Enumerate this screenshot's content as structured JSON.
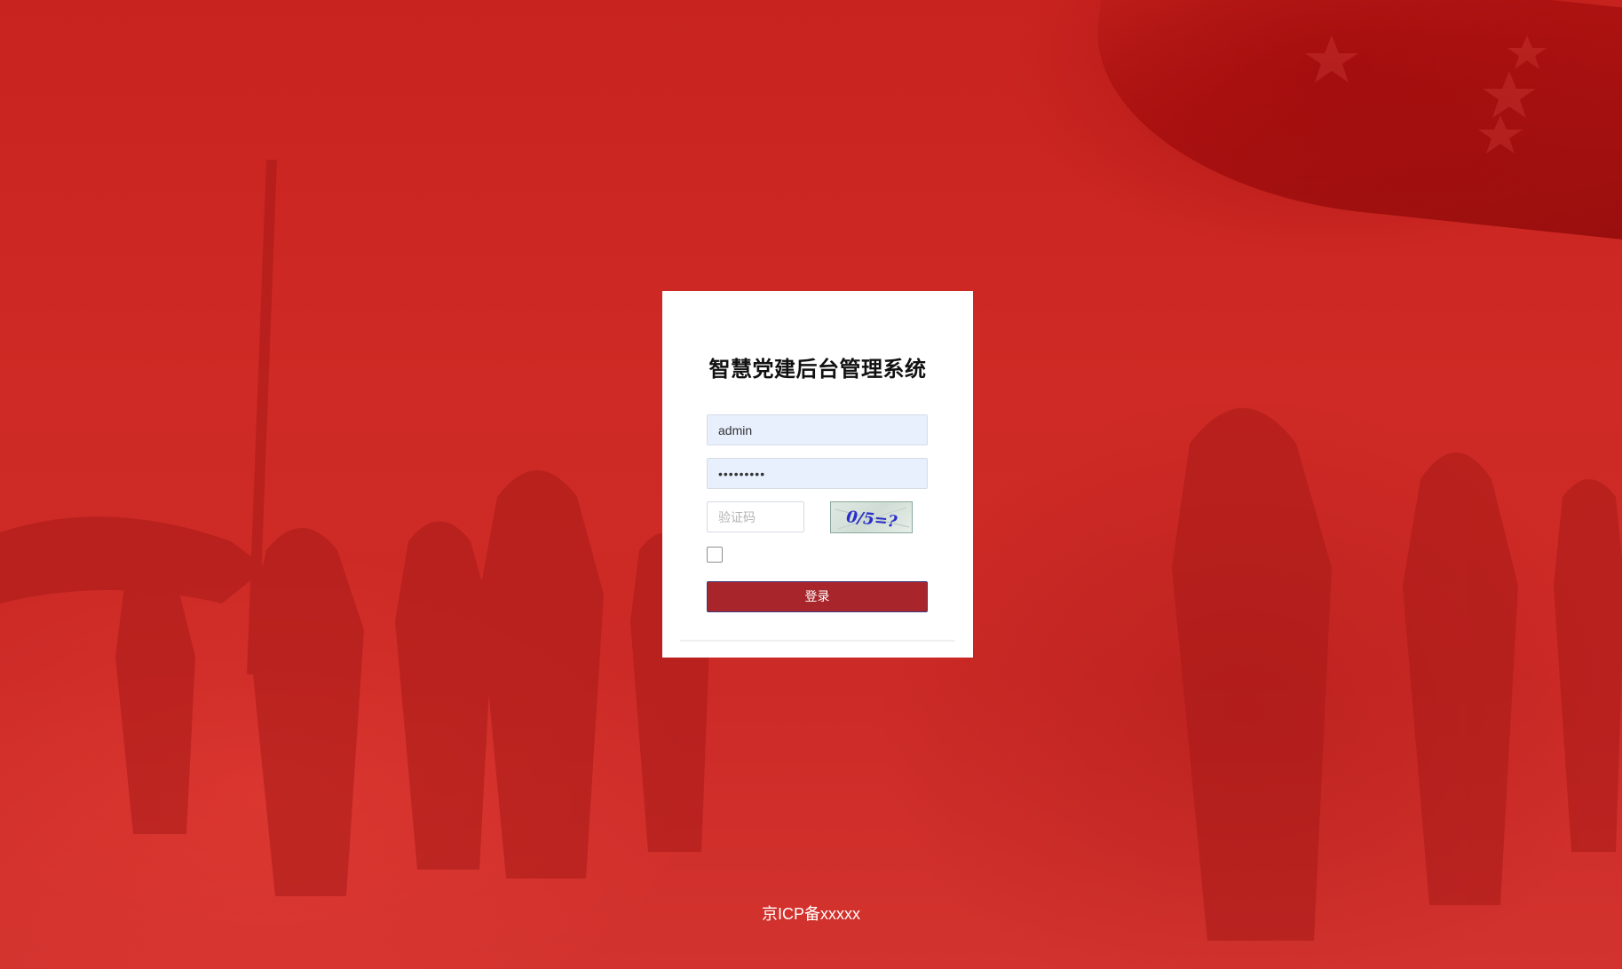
{
  "login": {
    "title": "智慧党建后台管理系统",
    "username_value": "admin",
    "password_value": "•••••••••",
    "captcha_placeholder": "验证码",
    "captcha_image_text": "0/5=?",
    "login_button_label": "登录"
  },
  "footer": {
    "icp_text": "京ICP备xxxxx"
  },
  "colors": {
    "background_red": "#cc2a26",
    "button_red": "#a8262b",
    "input_fill": "#e8f0fe"
  }
}
